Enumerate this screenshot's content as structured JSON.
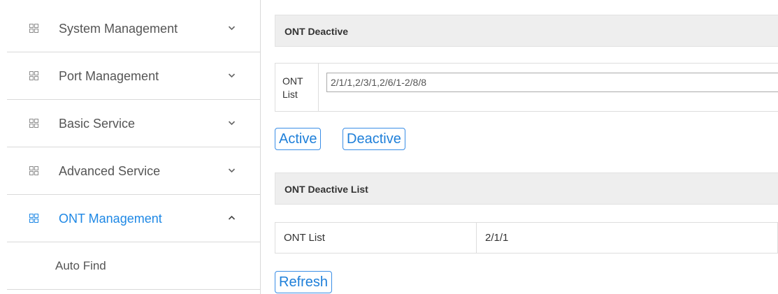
{
  "sidebar": {
    "menu": [
      {
        "label": "System Management",
        "icon": "grid-icon",
        "chevron": "chevron-down-icon",
        "expanded": false
      },
      {
        "label": "Port Management",
        "icon": "grid-icon",
        "chevron": "chevron-down-icon",
        "expanded": false
      },
      {
        "label": "Basic Service",
        "icon": "grid-icon",
        "chevron": "chevron-down-icon",
        "expanded": false
      },
      {
        "label": "Advanced Service",
        "icon": "grid-icon",
        "chevron": "chevron-down-icon",
        "expanded": false
      },
      {
        "label": "ONT Management",
        "icon": "grid-icon",
        "chevron": "chevron-up-icon",
        "expanded": true,
        "active": true
      }
    ],
    "submenu": [
      {
        "label": "Auto Find"
      }
    ]
  },
  "main": {
    "deactive_panel": {
      "title": "ONT Deactive",
      "ont_list_label": "ONT List",
      "ont_list_value": "2/1/1,2/3/1,2/6/1-2/8/8"
    },
    "buttons": {
      "active": "Active",
      "deactive": "Deactive",
      "refresh": "Refresh"
    },
    "list_panel": {
      "title": "ONT Deactive List",
      "rows": [
        {
          "key": "ONT List",
          "value": "2/1/1"
        }
      ]
    }
  },
  "colors": {
    "accent": "#1e88e5",
    "text_muted": "#555555",
    "header_bg": "#eeeeee",
    "border": "#dddddd",
    "icon_gray": "#8c8c8c"
  }
}
